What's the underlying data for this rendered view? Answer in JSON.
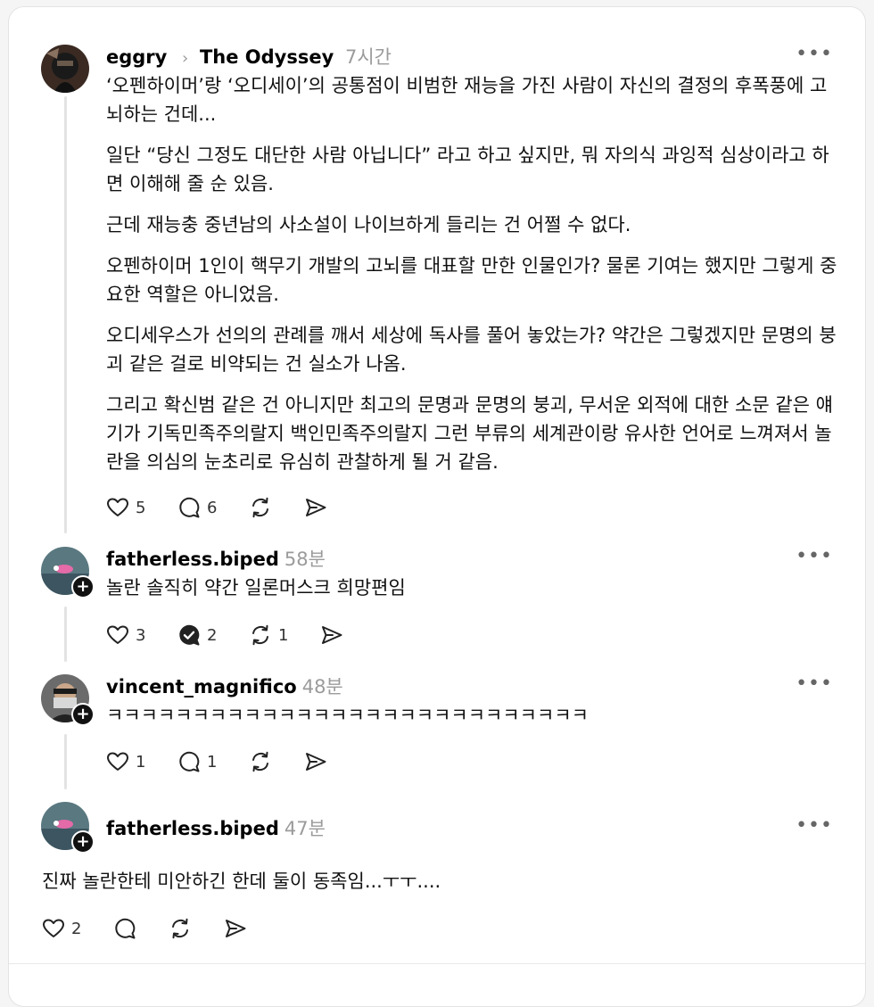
{
  "posts": [
    {
      "username": "eggry",
      "community": "The Odyssey",
      "time": "7시간",
      "paragraphs": [
        "‘오펜하이머’랑 ‘오디세이’의 공통점이 비범한 재능을 가진 사람이 자신의 결정의 후폭풍에 고뇌하는 건데...",
        "일단 “당신 그정도 대단한 사람 아닙니다” 라고 하고 싶지만, 뭐 자의식 과잉적 심상이라고 하면 이해해 줄 순 있음.",
        "근데 재능충 중년남의 사소설이 나이브하게 들리는 건 어쩔 수 없다.",
        "오펜하이머 1인이 핵무기 개발의 고뇌를 대표할 만한 인물인가? 물론 기여는 했지만 그렇게 중요한 역할은 아니었음.",
        "오디세우스가 선의의 관례를 깨서 세상에 독사를 풀어 놓았는가? 약간은 그렇겠지만 문명의 붕괴 같은 걸로 비약되는 건 실소가 나옴.",
        "그리고 확신범 같은 건 아니지만 최고의 문명과 문명의 붕괴, 무서운 외적에 대한 소문 같은 얘기가 기독민족주의랄지 백인민족주의랄지 그런 부류의 세계관이랑 유사한 언어로 느껴져서 놀란을 의심의 눈초리로 유심히 관찰하게 될 거 같음."
      ],
      "likes": "5",
      "replies": "6"
    },
    {
      "username": "fatherless.biped",
      "time": "58분",
      "text": "놀란 솔직히 약간 일론머스크 희망편임",
      "likes": "3",
      "replies": "2",
      "reposts": "1"
    },
    {
      "username": "vincent_magnifico",
      "time": "48분",
      "text": "ㅋㅋㅋㅋㅋㅋㅋㅋㅋㅋㅋㅋㅋㅋㅋㅋㅋㅋㅋㅋㅋㅋㅋㅋㅋㅋㅋㅋ",
      "likes": "1",
      "replies": "1"
    },
    {
      "username": "fatherless.biped",
      "time": "47분",
      "text": "진짜 놀란한테 미안하긴 한데 둘이 동족임...ㅜㅜ....",
      "likes": "2"
    }
  ],
  "icons": {
    "more": "more-icon",
    "like": "heart-icon",
    "reply": "comment-icon",
    "reply_checked": "comment-check-icon",
    "repost": "repost-icon",
    "share": "send-icon"
  },
  "colors": {
    "muted": "#9b9b9b",
    "line": "#e3e3e3"
  }
}
